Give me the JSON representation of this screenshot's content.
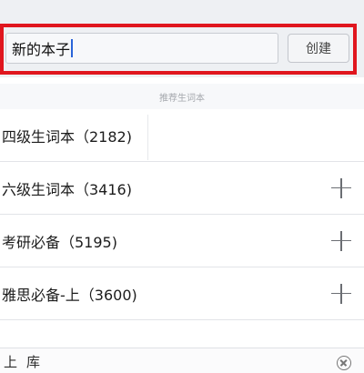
{
  "create_bar": {
    "input_value": "新的本子",
    "create_button_label": "创建",
    "highlight_color": "#e0161e"
  },
  "section_header": "推荐生词本",
  "recommended": [
    {
      "label": "四级生词本（2182)",
      "has_add": false
    },
    {
      "label": "六级生词本（3416)",
      "has_add": true
    },
    {
      "label": "考研必备（5195)",
      "has_add": true
    },
    {
      "label": "雅思必备-上（3600)",
      "has_add": true
    }
  ],
  "bottom_bar": {
    "left_text": "上库"
  }
}
